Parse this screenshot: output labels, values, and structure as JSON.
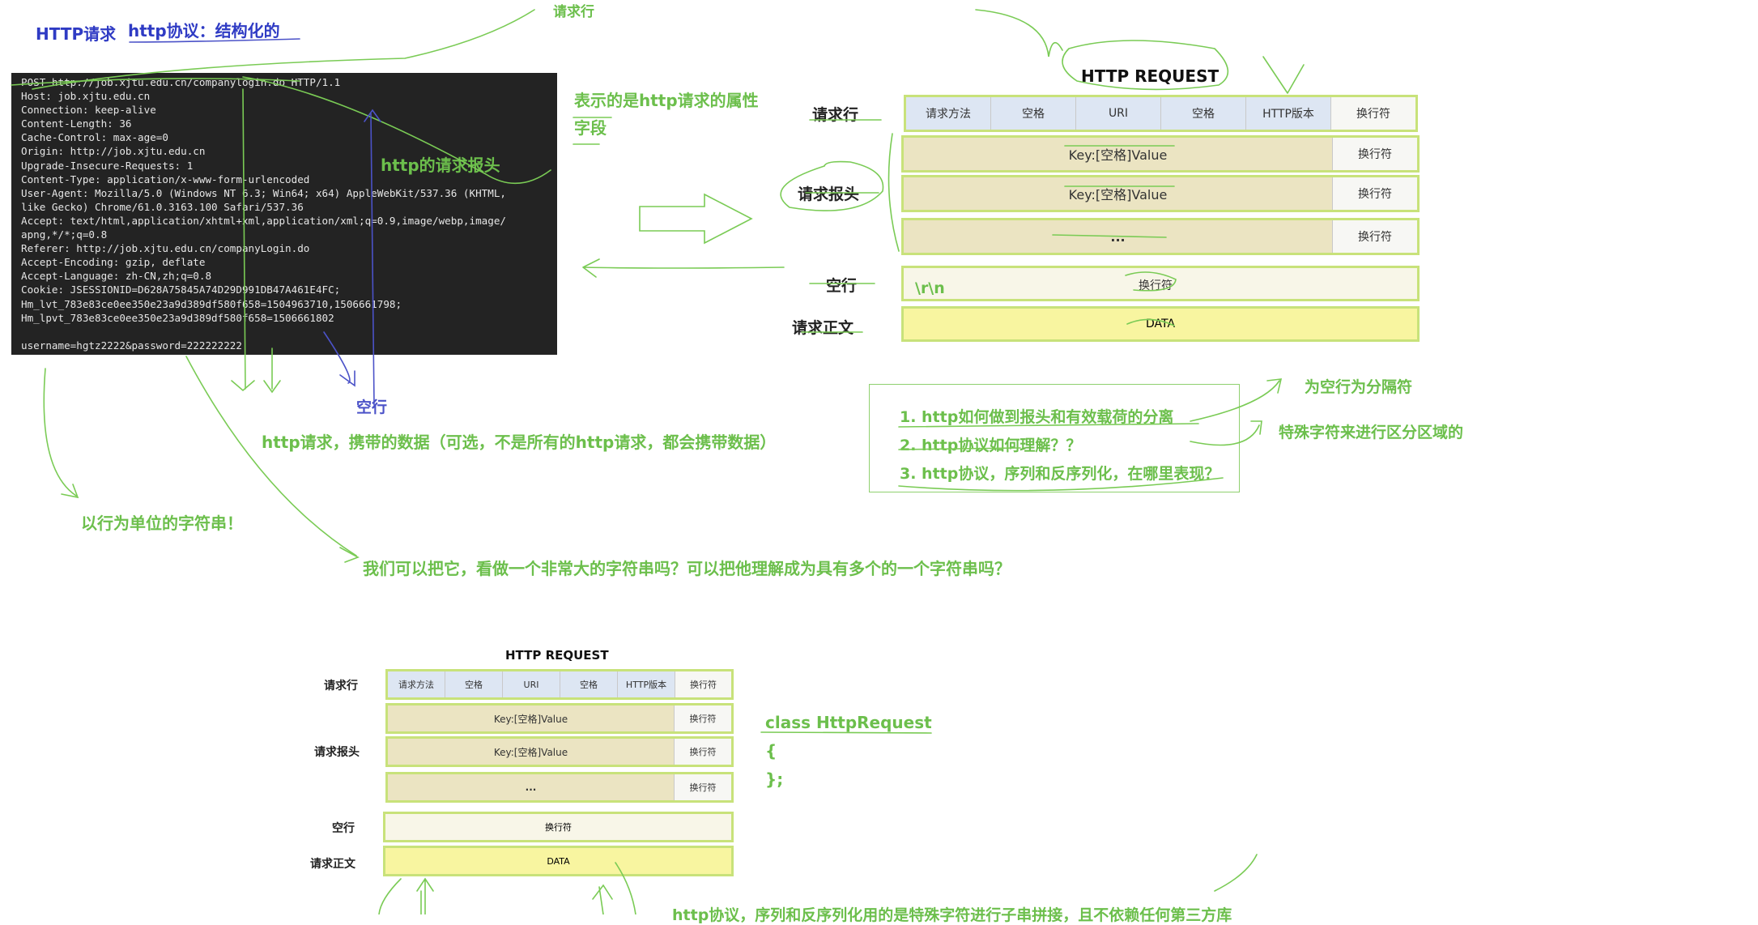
{
  "header": {
    "title": "HTTP请求",
    "subtitle": "http协议：结构化的",
    "top_fragment": "请求行"
  },
  "terminal": {
    "lines": [
      "POST http://job.xjtu.edu.cn/companylogin.do HTTP/1.1",
      "Host: job.xjtu.edu.cn",
      "Connection: keep-alive",
      "Content-Length: 36",
      "Cache-Control: max-age=0",
      "Origin: http://job.xjtu.edu.cn",
      "Upgrade-Insecure-Requests: 1",
      "Content-Type: application/x-www-form-urlencoded",
      "User-Agent: Mozilla/5.0 (Windows NT 6.3; Win64; x64) AppleWebKit/537.36 (KHTML,",
      "like Gecko) Chrome/61.0.3163.100 Safari/537.36",
      "Accept: text/html,application/xhtml+xml,application/xml;q=0.9,image/webp,image/",
      "apng,*/*;q=0.8",
      "Referer: http://job.xjtu.edu.cn/companyLogin.do",
      "Accept-Encoding: gzip, deflate",
      "Accept-Language: zh-CN,zh;q=0.8",
      "Cookie: JSESSIONID=D628A75845A74D29D991DB47A461E4FC;",
      "Hm_lvt_783e83ce0ee350e23a9d389df580f658=1504963710,1506661798;",
      "Hm_lpvt_783e83ce0ee350e23a9d389df580f658=1506661802",
      "",
      "username=hgtz2222&password=222222222"
    ]
  },
  "annotations": {
    "attr_fields_1": "表示的是http请求的属性",
    "attr_fields_2": "字段",
    "request_headers": "http的请求报头",
    "blank_line": "空行",
    "body_data": "http请求，携带的数据（可选，不是所有的http请求，都会携带数据）",
    "line_unit": "以行为单位的字符串！",
    "big_string": "我们可以把它，看做一个非常大的字符串吗？可以把他理解成为具有多个的一个字符串吗？",
    "blank_separator": "为空行为分隔符",
    "special_char": "特殊字符来进行区分区域的",
    "bottom_note": "http协议，序列和反序列化用的是特殊字符进行子串拼接，且不依赖任何第三方库"
  },
  "questions": [
    "1. http如何做到报头和有效载荷的分离",
    "2. http协议如何理解？？",
    "3. http协议，序列和反序列化，在哪里表现？"
  ],
  "diagram": {
    "title": "HTTP  REQUEST",
    "labels": {
      "request_line": "请求行",
      "request_headers": "请求报头",
      "blank_line": "空行",
      "request_body": "请求正文"
    },
    "request_line_cells": [
      "请求方法",
      "空格",
      "URI",
      "空格",
      "HTTP版本",
      "换行符"
    ],
    "header_rows": [
      {
        "text": "Key:[空格]Value",
        "newline": "换行符"
      },
      {
        "text": "Key:[空格]Value",
        "newline": "换行符"
      },
      {
        "text": "...",
        "newline": "换行符"
      }
    ],
    "blank_line_escape": "\\r\\n",
    "blank_line_cell": "换行符",
    "body_cell": "DATA"
  },
  "code": {
    "line1": "class HttpRequest",
    "line2": "{",
    "line3": "};"
  },
  "colors": {
    "annotation_green": "#6cbf4c",
    "title_blue": "#2f3bc4",
    "row_border": "#c8e27a",
    "cell_blue": "#dde6f3",
    "cell_tan": "#ebe4c2",
    "cell_yellow": "#f8f5a0"
  }
}
